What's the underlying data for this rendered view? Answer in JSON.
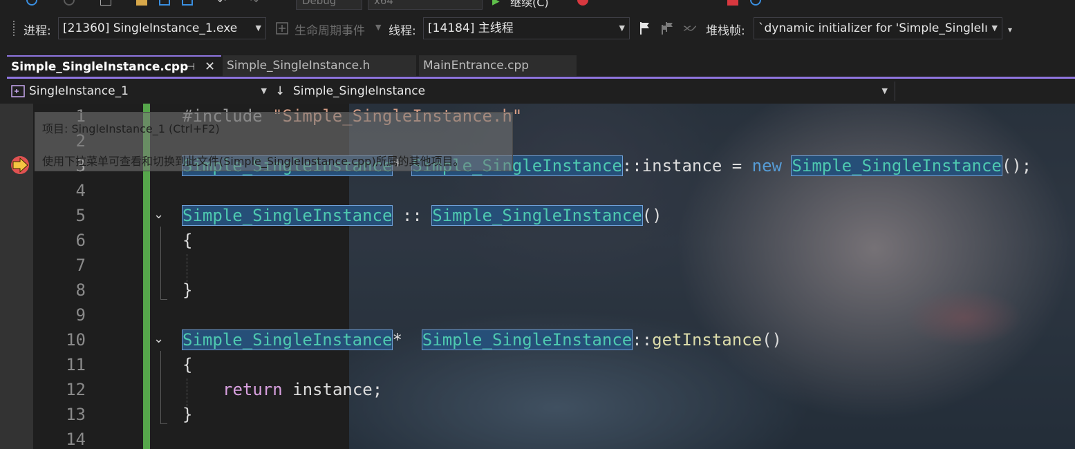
{
  "toolbar_top": {
    "config_value": "Debug",
    "platform_value": "x64",
    "continue_label": "继续(C)"
  },
  "debug_location": {
    "process_label": "进程:",
    "process_value": "[21360] SingleInstance_1.exe",
    "lifecycle_label": "生命周期事件",
    "thread_label": "线程:",
    "thread_value": "[14184] 主线程",
    "stackframe_label": "堆栈帧:",
    "stackframe_value": "`dynamic initializer for 'Simple_SingleIı"
  },
  "tabs": [
    {
      "label": "Simple_SingleInstance.cpp",
      "active": true
    },
    {
      "label": "Simple_SingleInstance.h",
      "active": false
    },
    {
      "label": "MainEntrance.cpp",
      "active": false
    }
  ],
  "navbar": {
    "project": "SingleInstance_1",
    "scope": "Simple_SingleInstance"
  },
  "tooltip": {
    "line1": "项目: SingleInstance_1 (Ctrl+F2)",
    "line2": "使用下拉菜单可查看和切换到此文件(Simple_SingleInstance.cpp)所属的其他项目。"
  },
  "editor": {
    "line_numbers": [
      "1",
      "2",
      "3",
      "4",
      "5",
      "6",
      "7",
      "8",
      "9",
      "10",
      "11",
      "12",
      "13",
      "14"
    ],
    "current_line": "3",
    "code": {
      "l1_pp": "#include ",
      "l1_str": "\"Simple_SingleInstance.h\"",
      "l3_t1": "Simple_SingleInstance",
      "l3_p1": "* ",
      "l3_t2": "Simple_SingleInstance",
      "l3_p2": "::instance = ",
      "l3_kw": "new",
      "l3_p3": " ",
      "l3_t3": "Simple_SingleInstance",
      "l3_p4": "();",
      "l5_t1": "Simple_SingleInstance",
      "l5_p1": " :: ",
      "l5_t2": "Simple_SingleInstance",
      "l5_p2": "()",
      "l6": "{",
      "l8": "}",
      "l10_t1": "Simple_SingleInstance",
      "l10_p1": "*  ",
      "l10_t2": "Simple_SingleInstance",
      "l10_p2": "::",
      "l10_fn": "getInstance",
      "l10_p3": "()",
      "l11": "{",
      "l12_kw": "return",
      "l12_p": " instance;",
      "l13": "}"
    }
  },
  "colors": {
    "accent": "#8f75e0",
    "change_bar": "#56a64b",
    "type_color": "#4ec9b0",
    "keyword": "#569cd6",
    "control_keyword": "#d8a0df",
    "string": "#d69d85"
  },
  "icons": [
    "grip-icon",
    "lifecycle-icon",
    "flag-icon",
    "flags-icon",
    "thread-filter-icon",
    "project-icon",
    "down-arrow-icon",
    "breakpoint-current-icon",
    "pin-icon",
    "close-icon"
  ]
}
